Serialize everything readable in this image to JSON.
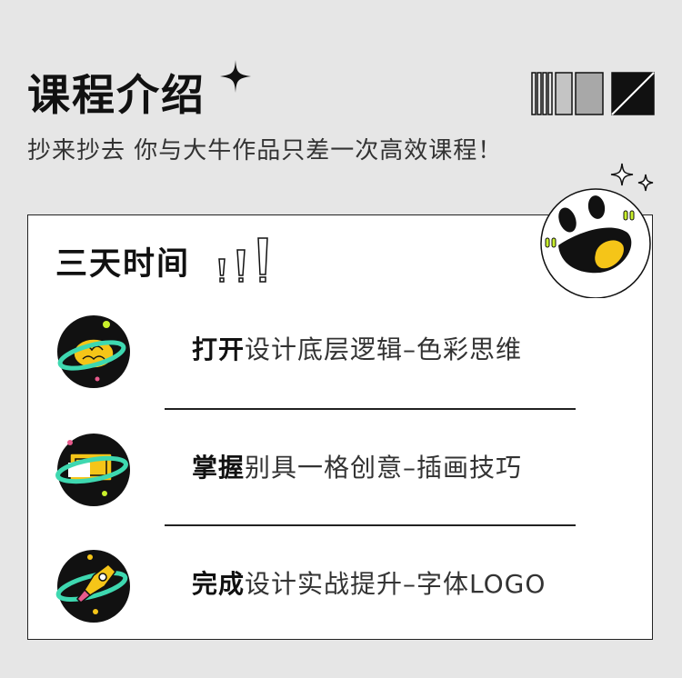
{
  "header": {
    "title": "课程介绍",
    "subtitle": "抄来抄去 你与大牛作品只差一次高效课程！"
  },
  "card": {
    "title": "三天时间",
    "items": [
      {
        "strong": "打开",
        "rest": "设计底层逻辑–色彩思维",
        "icon": "brain-planet-icon"
      },
      {
        "strong": "掌握",
        "rest": "别具一格创意–插画技巧",
        "icon": "screen-planet-icon"
      },
      {
        "strong": "完成",
        "rest": "设计实战提升–字体LOGO",
        "icon": "rocket-planet-icon"
      }
    ]
  },
  "colors": {
    "background": "#e6e6e6",
    "accent_yellow": "#f5c518",
    "accent_teal": "#3ed8b0",
    "accent_lime": "#c9f02b",
    "accent_pink": "#e85a8c",
    "ink": "#111111"
  }
}
